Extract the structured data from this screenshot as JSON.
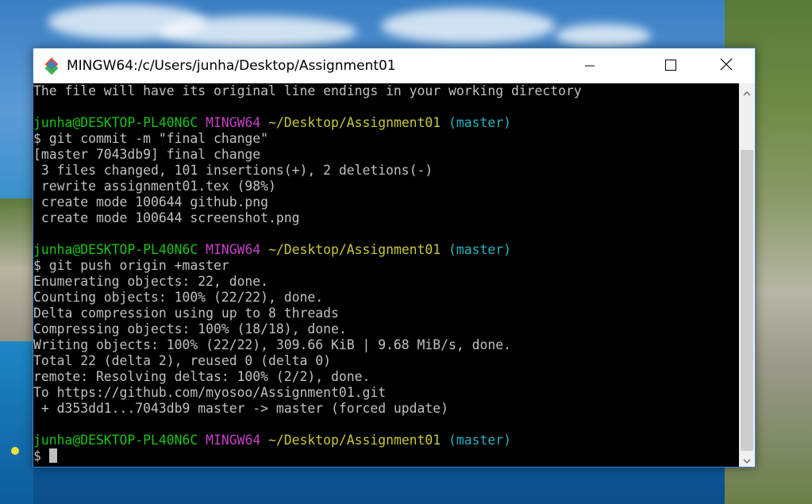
{
  "window": {
    "title": "MINGW64:/c/Users/junha/Desktop/Assignment01"
  },
  "colors": {
    "user": "#17c317",
    "system": "#c640c6",
    "path": "#c8c83a",
    "branch": "#22b3c0",
    "text": "#c0c0c0"
  },
  "terminal": {
    "lines": [
      {
        "text": "The file will have its original line endings in your working directory"
      },
      {
        "text": ""
      },
      {
        "prompt": {
          "user": "junha@DESKTOP-PL40N6C",
          "system": "MINGW64",
          "path": "~/Desktop/Assignment01",
          "branch": "(master)"
        }
      },
      {
        "text": "$ git commit -m \"final change\""
      },
      {
        "text": "[master 7043db9] final change"
      },
      {
        "text": " 3 files changed, 101 insertions(+), 2 deletions(-)"
      },
      {
        "text": " rewrite assignment01.tex (98%)"
      },
      {
        "text": " create mode 100644 github.png"
      },
      {
        "text": " create mode 100644 screenshot.png"
      },
      {
        "text": ""
      },
      {
        "prompt": {
          "user": "junha@DESKTOP-PL40N6C",
          "system": "MINGW64",
          "path": "~/Desktop/Assignment01",
          "branch": "(master)"
        }
      },
      {
        "text": "$ git push origin +master"
      },
      {
        "text": "Enumerating objects: 22, done."
      },
      {
        "text": "Counting objects: 100% (22/22), done."
      },
      {
        "text": "Delta compression using up to 8 threads"
      },
      {
        "text": "Compressing objects: 100% (18/18), done."
      },
      {
        "text": "Writing objects: 100% (22/22), 309.66 KiB | 9.68 MiB/s, done."
      },
      {
        "text": "Total 22 (delta 2), reused 0 (delta 0)"
      },
      {
        "text": "remote: Resolving deltas: 100% (2/2), done."
      },
      {
        "text": "To https://github.com/myosoo/Assignment01.git"
      },
      {
        "text": " + d353dd1...7043db9 master -> master (forced update)"
      },
      {
        "text": ""
      },
      {
        "prompt": {
          "user": "junha@DESKTOP-PL40N6C",
          "system": "MINGW64",
          "path": "~/Desktop/Assignment01",
          "branch": "(master)"
        }
      },
      {
        "text": "$ ",
        "cursor": true
      }
    ]
  },
  "icons": {
    "app": "git-bash-icon",
    "minimize": "minimize-icon",
    "maximize": "maximize-icon",
    "close": "close-icon",
    "scroll_up": "chevron-up-icon",
    "scroll_down": "chevron-down-icon"
  }
}
